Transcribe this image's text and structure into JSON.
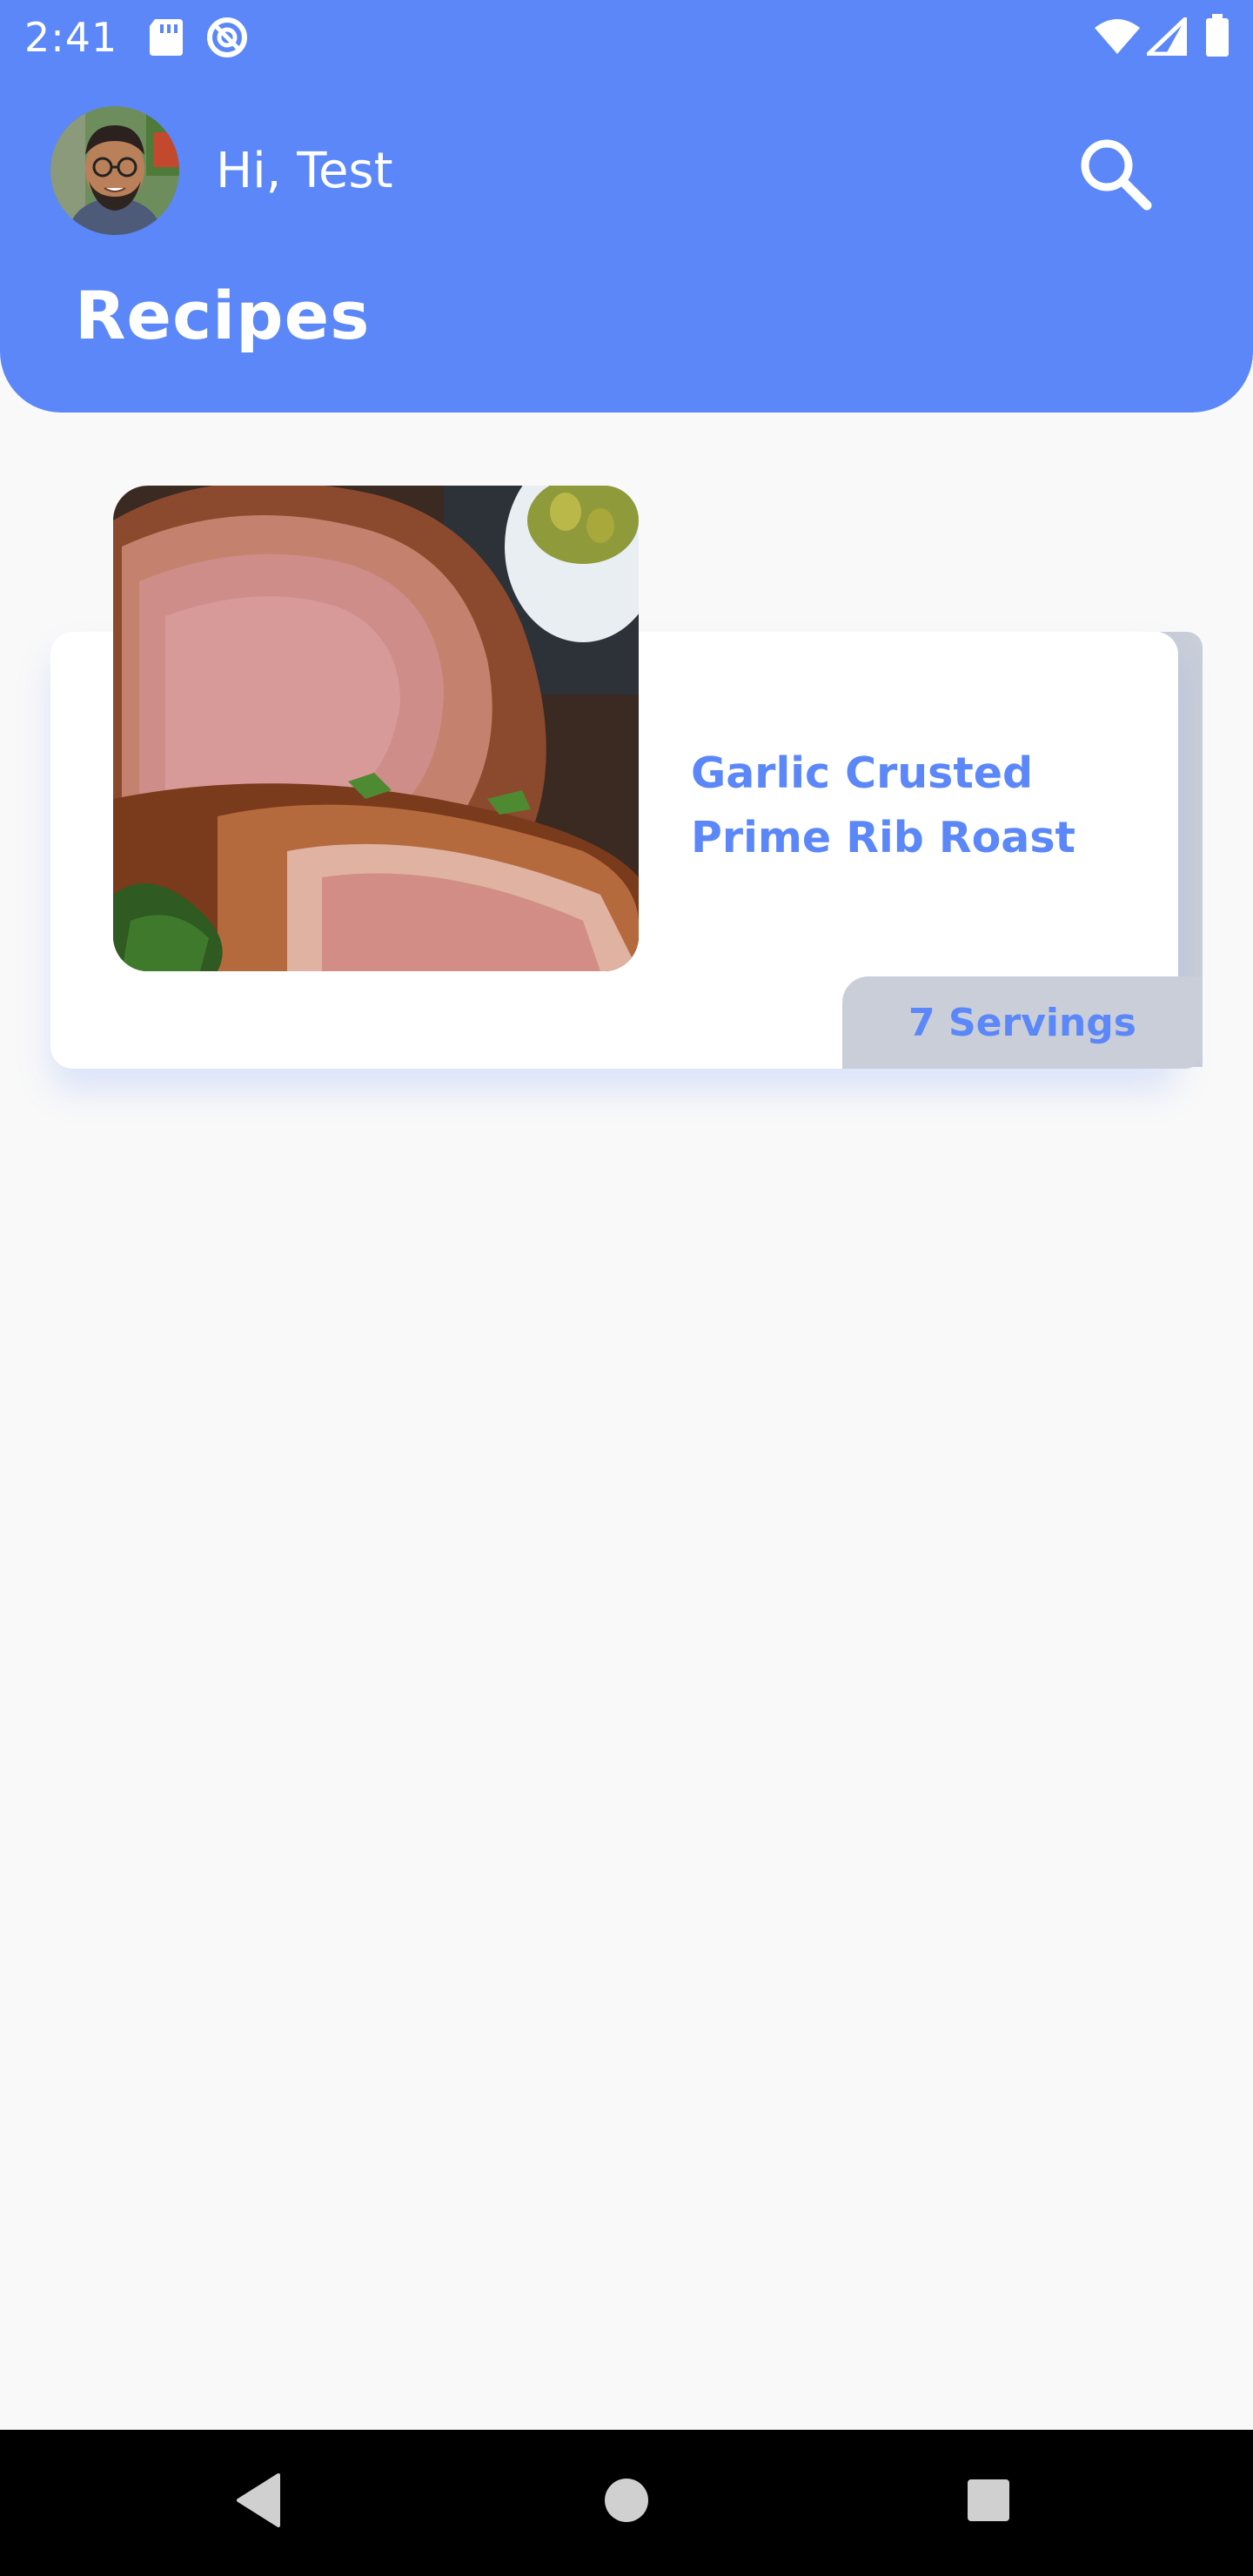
{
  "status_bar": {
    "time": "2:41",
    "icons": [
      "sd-card-icon",
      "sync-icon",
      "wifi-icon",
      "signal-icon",
      "battery-icon"
    ]
  },
  "header": {
    "greeting": "Hi, Test",
    "title": "Recipes",
    "search_icon": "search-icon",
    "accent_color": "#5b87f9"
  },
  "recipes": [
    {
      "title": "Garlic Crusted Prime Rib Roast",
      "servings": "7 Servings"
    }
  ],
  "nav_bar": {
    "buttons": [
      "back-icon",
      "home-icon",
      "recents-icon"
    ]
  }
}
